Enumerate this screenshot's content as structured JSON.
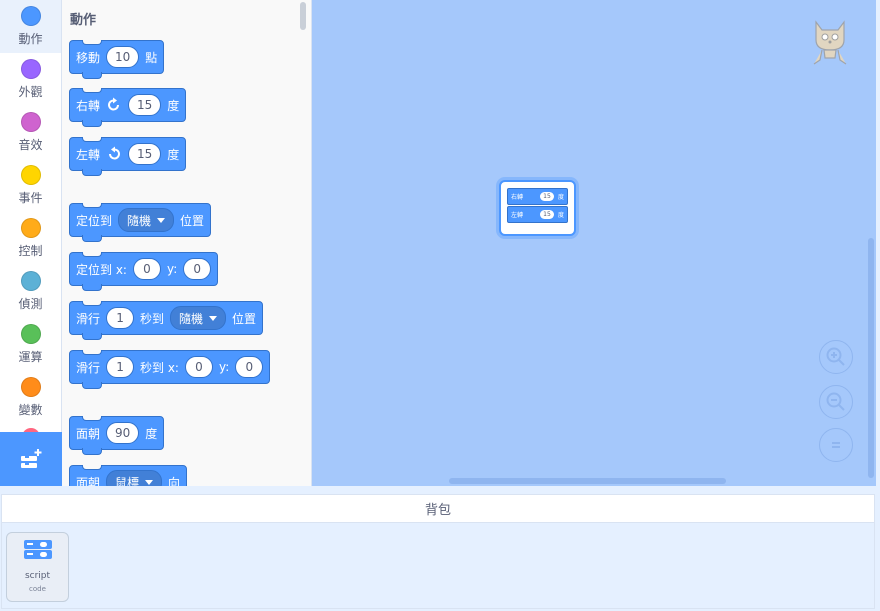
{
  "categories": [
    {
      "label": "動作",
      "color": "#4c97ff",
      "selected": true
    },
    {
      "label": "外觀",
      "color": "#9966ff",
      "selected": false
    },
    {
      "label": "音效",
      "color": "#cf63cf",
      "selected": false
    },
    {
      "label": "事件",
      "color": "#ffd500",
      "selected": false
    },
    {
      "label": "控制",
      "color": "#ffab19",
      "selected": false
    },
    {
      "label": "偵測",
      "color": "#5cb1d6",
      "selected": false
    },
    {
      "label": "運算",
      "color": "#59c059",
      "selected": false
    },
    {
      "label": "變數",
      "color": "#ff8c1a",
      "selected": false
    }
  ],
  "category_peek_color": "#ff6680",
  "extension_icon": "add-extension-icon",
  "palette": {
    "title": "動作",
    "move": {
      "label": "移動",
      "value": "10",
      "unit": "點"
    },
    "turn_right": {
      "label": "右轉",
      "icon": "rotate-clockwise-icon",
      "value": "15",
      "unit": "度"
    },
    "turn_left": {
      "label": "左轉",
      "icon": "rotate-counterclockwise-icon",
      "value": "15",
      "unit": "度"
    },
    "goto": {
      "label": "定位到",
      "option": "隨機",
      "suffix": "位置"
    },
    "goto_xy": {
      "label": "定位到 x:",
      "x": "0",
      "ylabel": "y:",
      "y": "0"
    },
    "glide": {
      "label": "滑行",
      "secs": "1",
      "mid": "秒到",
      "option": "隨機",
      "suffix": "位置"
    },
    "glide_xy": {
      "label": "滑行",
      "secs": "1",
      "mid": "秒到 x:",
      "x": "0",
      "ylabel": "y:",
      "y": "0"
    },
    "point": {
      "label": "面朝",
      "value": "90",
      "unit": "度"
    },
    "point_towards": {
      "label": "面朝",
      "option": "鼠標",
      "suffix": "向"
    }
  },
  "script": {
    "b1": {
      "label": "右轉",
      "value": "15",
      "unit": "度"
    },
    "b2": {
      "label": "左轉",
      "value": "15",
      "unit": "度"
    }
  },
  "zoom": {
    "in_icon": "zoom-in-icon",
    "out_icon": "zoom-out-icon",
    "reset_icon": "zoom-reset-icon"
  },
  "backpack": {
    "title": "背包",
    "items": [
      {
        "name": "script",
        "type": "code"
      }
    ]
  },
  "colors": {
    "motion": "#4c97ff",
    "workspace": "#a5c8fb",
    "accent": "#4c97ff"
  }
}
